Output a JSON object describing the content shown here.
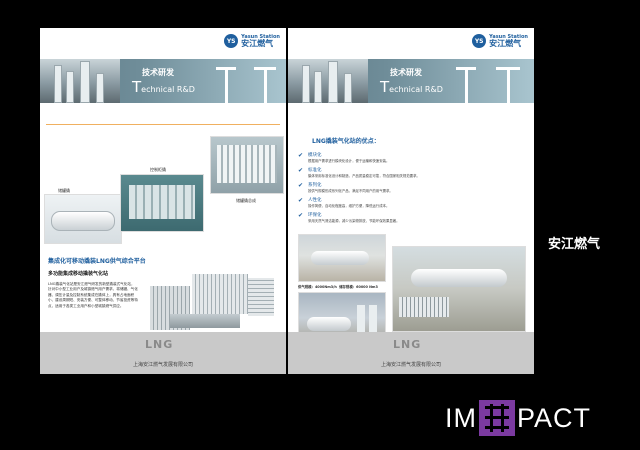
{
  "left_page": {
    "logo": {
      "en": "Yasun Station",
      "cn": "安江燃气",
      "mark": "YS"
    },
    "banner": {
      "title_cn": "技术研发",
      "title_en_initial": "T",
      "title_en_rest": "echnical R&D"
    },
    "captions": {
      "storage_tank": "储罐撬",
      "control_cabinet": "控制柜撬",
      "vaporizer": "储罐撬总成",
      "station_diagram": "气化调压计量组合撬（图）"
    },
    "section_title": "集成化可移动撬装LNG供气综合平台",
    "section_subtitle": "多功能集成移动撬装气化站",
    "paragraph": "LNG撬装气化站是安江燃气研发的新型撬装式气化站，针对中小型工业用户及城镇燃气用户需求，将储罐、气化器、调压计量及控制系统集成在撬体上，具有占地面积小、建设周期短、安装方便、可整体移动、节省投资等特点，适用于各类工业用户和小型城镇燃气供应。",
    "footer": {
      "logo": "LNG",
      "company": "上海安江燃气发展有限公司"
    }
  },
  "right_page": {
    "logo": {
      "en": "Yasun Station",
      "cn": "安江燃气",
      "mark": "YS"
    },
    "banner": {
      "title_cn": "技术研发",
      "title_en_initial": "T",
      "title_en_rest": "echnical R&D"
    },
    "advantages_title": "LNG撬装气化站的优点：",
    "advantages": [
      {
        "name": "模块化",
        "desc": "根据用户需求进行模块化设计，便于运输和快速安装。"
      },
      {
        "name": "标准化",
        "desc": "撬体采用标准化设计和制造，产品质量稳定可靠，符合国家相关规范要求。"
      },
      {
        "name": "系列化",
        "desc": "按供气规模形成系列化产品，满足不同用户的用气需求。"
      },
      {
        "name": "人性化",
        "desc": "操作简便，自动化程度高，维护方便，降低运行成本。"
      },
      {
        "name": "环保化",
        "desc": "采用天然气清洁能源，减少污染物排放，节能环保效果显著。"
      }
    ],
    "specs": [
      {
        "label": "供气规模：4000Nm3/h",
        "volume": "储存规模：60000 Nm3"
      },
      {
        "label": "供气规模：6000Nm3/h",
        "volume": "储存规模：60000 Nm3"
      },
      {
        "label": "供气规模：900 Nm3/h",
        "volume": "储存规模：20000 Nm3"
      }
    ],
    "footer": {
      "logo": "LNG",
      "company": "上海安江燃气发展有限公司"
    }
  },
  "side_label": "安江燃气",
  "brand": {
    "left": "IM",
    "right": "PACT"
  },
  "colors": {
    "accent": "#1f5f9e",
    "banner": "#6f8d99",
    "footer": "#c9c9c9",
    "brand_mark": "#7b3aa0"
  }
}
